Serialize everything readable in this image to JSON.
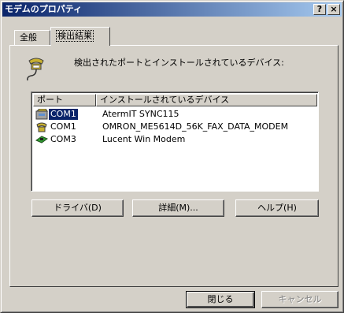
{
  "window": {
    "title": "モデムのプロパティ",
    "help_button": "?",
    "close_button": "×"
  },
  "tabs": [
    {
      "label": "全般"
    },
    {
      "label": "検出結果"
    }
  ],
  "heading": "検出されたポートとインストールされているデバイス:",
  "list": {
    "columns": [
      "ポート",
      "インストールされているデバイス"
    ],
    "rows": [
      {
        "port": "COM1",
        "device": "AtermIT SYNC115",
        "selected": true,
        "icon": "phone-modem-icon"
      },
      {
        "port": "COM1",
        "device": "OMRON_ME5614D_56K_FAX_DATA_MODEM",
        "selected": false,
        "icon": "phone-modem-icon"
      },
      {
        "port": "COM3",
        "device": "Lucent Win Modem",
        "selected": false,
        "icon": "pci-card-icon"
      }
    ]
  },
  "buttons": {
    "driver": "ドライバ(D)",
    "details": "詳細(M)...",
    "help": "ヘルプ(H)",
    "close": "閉じる",
    "cancel": "キャンセル"
  }
}
